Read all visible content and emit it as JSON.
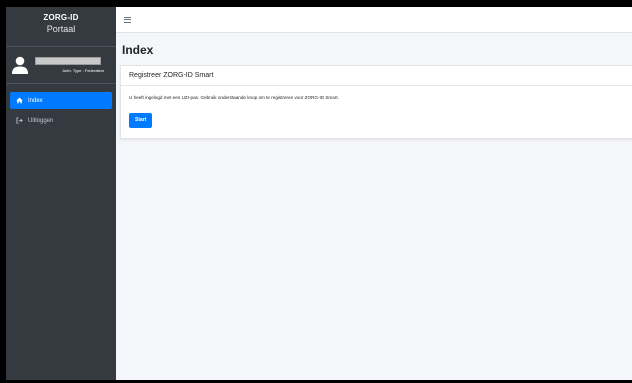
{
  "sidebar": {
    "brand_line1": "ZORG-ID",
    "brand_line2": "Portaal",
    "user": {
      "auth_type": "Auth. Type : Federation"
    },
    "items": [
      {
        "label": "Index",
        "icon": "home-icon",
        "active": true
      },
      {
        "label": "Uitloggen",
        "icon": "sign-out-icon",
        "active": false
      }
    ]
  },
  "main": {
    "page_title": "Index",
    "card": {
      "title": "Registreer ZORG-ID Smart",
      "text": "U heeft ingelogd met een UZI-pas. Gebruik onderstaande knop om te registreren voor ZORG-ID Smart.",
      "button_label": "Start"
    }
  },
  "colors": {
    "sidebar_bg": "#343a40",
    "accent": "#007bff",
    "content_bg": "#f4f6f9"
  }
}
